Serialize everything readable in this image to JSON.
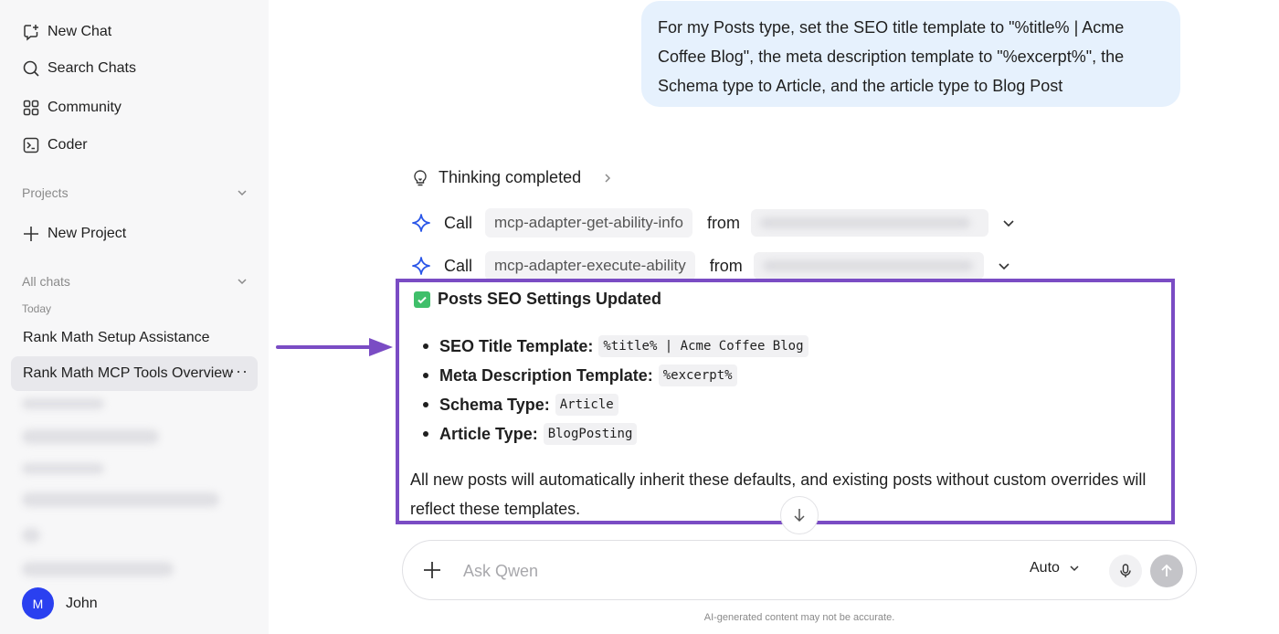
{
  "sidebar": {
    "nav": {
      "new_chat": "New Chat",
      "search_chats": "Search Chats",
      "community": "Community",
      "coder": "Coder"
    },
    "projects_label": "Projects",
    "new_project": "New Project",
    "all_chats_label": "All chats",
    "today_label": "Today",
    "chats": [
      "Rank Math Setup Assistance",
      "Rank Math MCP Tools Overview"
    ],
    "more_glyph": "···",
    "user": {
      "initial": "M",
      "name": "John"
    }
  },
  "conversation": {
    "user_message": "For my Posts type, set the SEO title template to \"%title% | Acme Coffee Blog\", the meta description template to \"%excerpt%\", the Schema type to Article, and the article type to Blog Post",
    "thinking_label": "Thinking completed",
    "calls": [
      {
        "call_label": "Call",
        "tool": "mcp-adapter-get-ability-info",
        "from_label": "from"
      },
      {
        "call_label": "Call",
        "tool": "mcp-adapter-execute-ability",
        "from_label": "from"
      }
    ],
    "answer": {
      "title": "Posts SEO Settings Updated",
      "items": [
        {
          "key": "SEO Title Template:",
          "value": "%title% | Acme Coffee Blog"
        },
        {
          "key": "Meta Description Template:",
          "value": "%excerpt%"
        },
        {
          "key": "Schema Type:",
          "value": "Article"
        },
        {
          "key": "Article Type:",
          "value": "BlogPosting"
        }
      ],
      "footer": "All new posts will automatically inherit these defaults, and existing posts without custom overrides will reflect these templates."
    }
  },
  "composer": {
    "placeholder": "Ask Qwen",
    "mode": "Auto",
    "disclaimer": "AI-generated content may not be accurate."
  },
  "colors": {
    "highlight_border": "#7a4cc4",
    "user_bubble": "#e6f1fd",
    "avatar": "#2a40f0",
    "check": "#3fbf6a",
    "sparkle": "#2a56e8"
  }
}
